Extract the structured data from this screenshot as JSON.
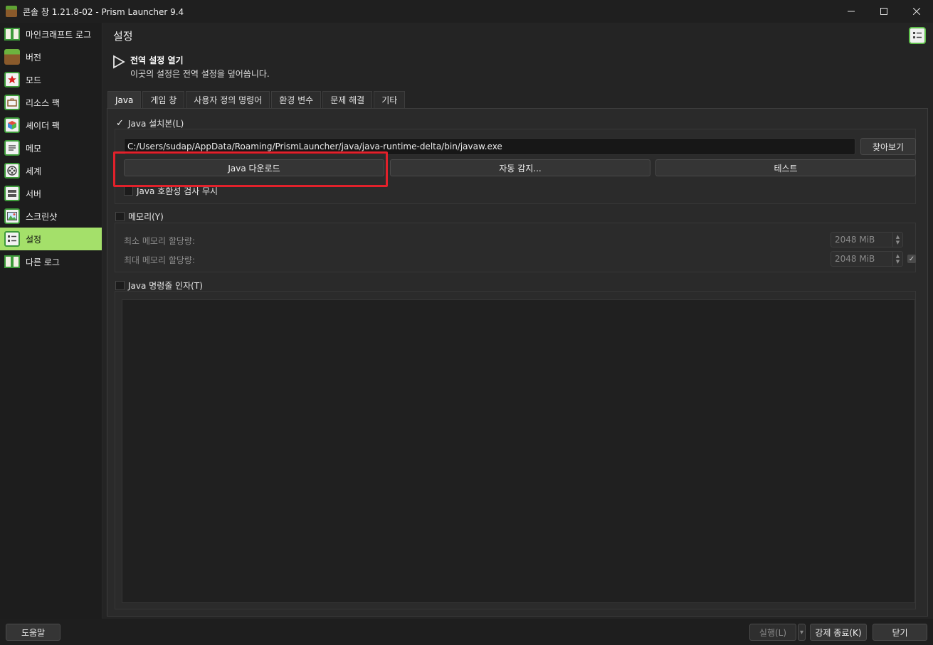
{
  "window": {
    "title": "콘솔 창 1.21.8-02 - Prism Launcher 9.4",
    "minimize_glyph": "—",
    "maximize_glyph": "☐",
    "close_glyph": "✕"
  },
  "sidebar": {
    "items": [
      {
        "label": "마인크래프트 로그",
        "icon": "book-icon"
      },
      {
        "label": "버전",
        "icon": "grass-block-icon"
      },
      {
        "label": "모드",
        "icon": "star-icon"
      },
      {
        "label": "리소스 팩",
        "icon": "briefcase-icon"
      },
      {
        "label": "셰이더 팩",
        "icon": "cube-icon"
      },
      {
        "label": "메모",
        "icon": "notes-icon"
      },
      {
        "label": "세계",
        "icon": "film-reel-icon"
      },
      {
        "label": "서버",
        "icon": "server-icon"
      },
      {
        "label": "스크린샷",
        "icon": "picture-icon"
      },
      {
        "label": "설정",
        "icon": "settings-list-icon",
        "active": true
      },
      {
        "label": "다른 로그",
        "icon": "book-icon"
      }
    ]
  },
  "main": {
    "page_title": "설정",
    "global_note": {
      "title": "전역 설정 열기",
      "description": "이곳의 설정은 전역 설정을 덮어씁니다."
    },
    "tabs": [
      {
        "label": "Java",
        "active": true
      },
      {
        "label": "게임 창"
      },
      {
        "label": "사용자 정의 명령어"
      },
      {
        "label": "환경 변수"
      },
      {
        "label": "문제 해결"
      },
      {
        "label": "기타"
      }
    ],
    "java_section": {
      "checkbox_label": "Java 설치본(L)",
      "checked": true,
      "check_glyph": "✓",
      "path_value": "C:/Users/sudap/AppData/Roaming/PrismLauncher/java/java-runtime-delta/bin/javaw.exe",
      "browse_label": "찾아보기",
      "download_label": "Java 다운로드",
      "autodetect_label": "자동 감지...",
      "test_label": "테스트",
      "compat_check_label": "Java 호환성 검사 무시"
    },
    "memory_section": {
      "checkbox_label": "메모리(Y)",
      "checked": false,
      "min_label": "최소 메모리 할당량:",
      "min_value": "2048 MiB",
      "max_label": "최대 메모리 할당량:",
      "max_value": "2048 MiB",
      "max_check_glyph": "✓"
    },
    "args_section": {
      "checkbox_label": "Java 명령줄 인자(T)",
      "checked": false
    }
  },
  "bottom_bar": {
    "help_label": "도움말",
    "run_label": "실행(L)",
    "run_dropdown_glyph": "▾",
    "kill_label": "강제 종료(K)",
    "close_label": "닫기"
  },
  "colors": {
    "accent_green": "#a4e06a",
    "highlight_red": "#e2212b"
  }
}
